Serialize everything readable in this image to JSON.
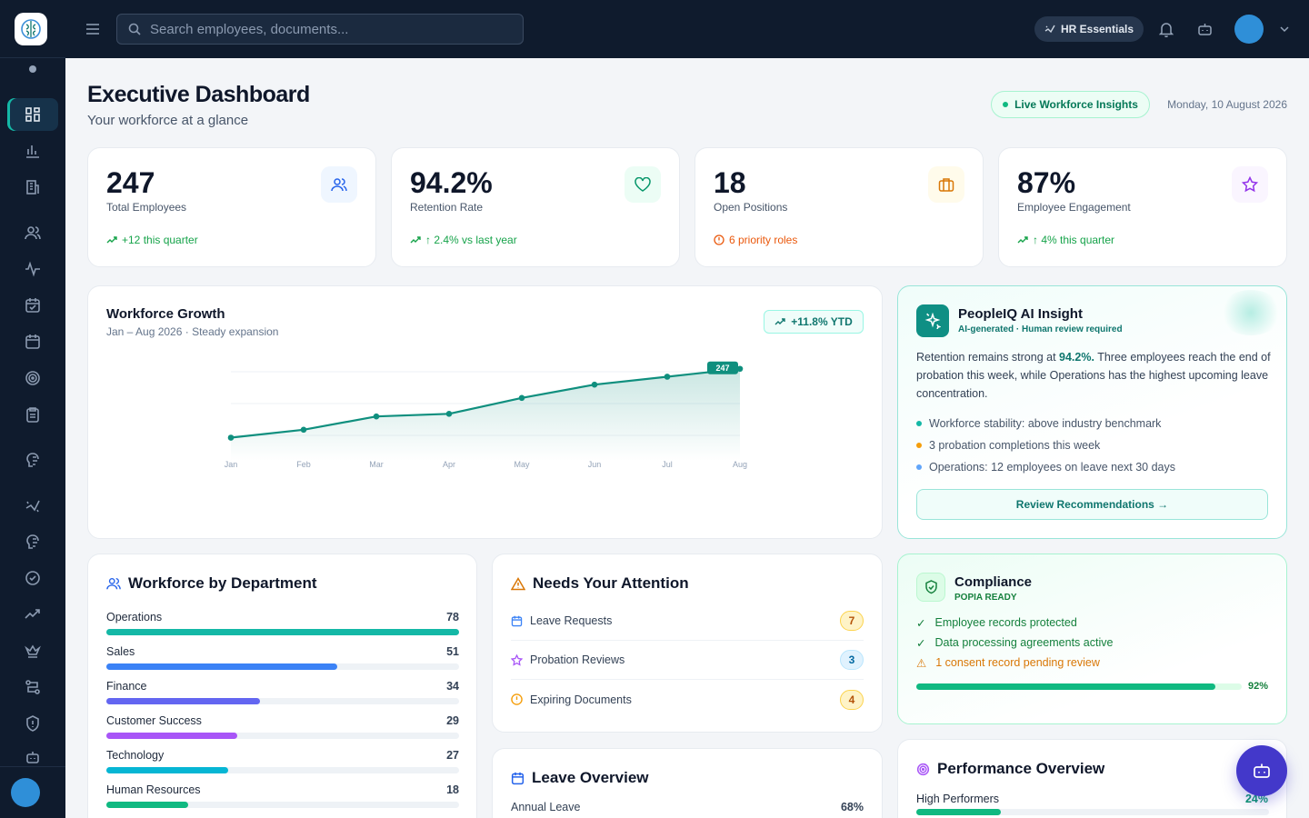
{
  "topbar": {
    "search_placeholder": "Search employees, documents...",
    "hr_pill": "HR Essentials"
  },
  "header": {
    "title": "Executive Dashboard",
    "subtitle": "Your workforce at a glance",
    "live_pill": "Live Workforce Insights",
    "date": "Monday, 10 August 2026"
  },
  "kpis": [
    {
      "value": "247",
      "label": "Total Employees",
      "foot": "+12 this quarter",
      "icon": "users-icon",
      "foot_color": "#16a34a",
      "accent": "#2563eb"
    },
    {
      "value": "94.2%",
      "label": "Retention Rate",
      "foot": "↑ 2.4% vs last year",
      "icon": "heart-icon",
      "foot_color": "#16a34a",
      "accent": "#059669"
    },
    {
      "value": "18",
      "label": "Open Positions",
      "foot": "6 priority roles",
      "icon": "briefcase-icon",
      "foot_color": "#ea580c",
      "accent": "#d97706"
    },
    {
      "value": "87%",
      "label": "Employee Engagement",
      "foot": "↑ 4% this quarter",
      "icon": "star-icon",
      "foot_color": "#16a34a",
      "accent": "#9333ea"
    }
  ],
  "growth": {
    "title": "Workforce Growth",
    "subtitle": "Jan – Aug 2026 · Steady expansion",
    "ytd": "+11.8% YTD"
  },
  "chart_data": {
    "type": "area",
    "title": "Workforce Growth",
    "x": [
      "Jan",
      "Feb",
      "Mar",
      "Apr",
      "May",
      "Jun",
      "Jul",
      "Aug"
    ],
    "values": [
      221,
      224,
      229,
      230,
      236,
      241,
      244,
      247
    ],
    "ylim": [
      215,
      250
    ],
    "last_label": "247",
    "color": "#0f8f7e",
    "grid": true
  },
  "ai": {
    "title": "PeopleIQ AI Insight",
    "subtitle": "AI-generated · Human review required",
    "body_pre": "Retention remains strong at ",
    "body_bold": "94.2%.",
    "body_post": " Three employees reach the end of probation this week, while Operations has the highest upcoming leave concentration.",
    "bullets": [
      {
        "text": "Workforce stability: above industry benchmark",
        "color": "#14b8a6"
      },
      {
        "text": "3 probation completions this week",
        "color": "#f59e0b"
      },
      {
        "text": "Operations: 12 employees on leave next 30 days",
        "color": "#60a5fa"
      }
    ],
    "button": "Review Recommendations →"
  },
  "departments": {
    "title": "Workforce by Department",
    "max": 78,
    "rows": [
      {
        "name": "Operations",
        "count": "78",
        "value": 78,
        "color": "#14b8a6"
      },
      {
        "name": "Sales",
        "count": "51",
        "value": 51,
        "color": "#3b82f6"
      },
      {
        "name": "Finance",
        "count": "34",
        "value": 34,
        "color": "#6366f1"
      },
      {
        "name": "Customer Success",
        "count": "29",
        "value": 29,
        "color": "#a855f7"
      },
      {
        "name": "Technology",
        "count": "27",
        "value": 27,
        "color": "#06b6d4"
      },
      {
        "name": "Human Resources",
        "count": "18",
        "value": 18,
        "color": "#10b981"
      }
    ]
  },
  "attention": {
    "title": "Needs Your Attention",
    "items": [
      {
        "label": "Leave Requests",
        "count": "7",
        "icon": "calendar-icon"
      },
      {
        "label": "Probation Reviews",
        "count": "3",
        "icon": "star-icon"
      },
      {
        "label": "Expiring Documents",
        "count": "4",
        "icon": "clock-icon"
      }
    ]
  },
  "leave": {
    "title": "Leave Overview",
    "row_label": "Annual Leave",
    "row_value": "68%"
  },
  "compliance": {
    "title": "Compliance",
    "badge": "POPIA READY",
    "items": [
      {
        "text": "Employee records protected",
        "mark": "✓",
        "color": "#15803d"
      },
      {
        "text": "Data processing agreements active",
        "mark": "✓",
        "color": "#15803d"
      },
      {
        "text": "1 consent record pending review",
        "mark": "⚠",
        "color": "#d97706"
      }
    ],
    "progress": 0.92,
    "progress_label": "92%"
  },
  "performance": {
    "title": "Performance Overview",
    "row_label": "High Performers",
    "row_value": "24%",
    "progress": 0.24
  }
}
